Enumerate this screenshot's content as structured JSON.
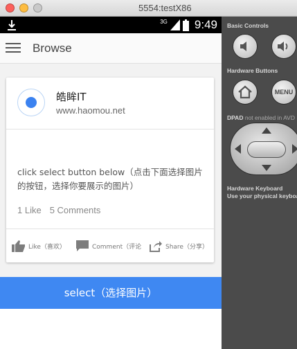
{
  "window": {
    "title": "5554:testX86"
  },
  "statusbar": {
    "network": "3G",
    "time": "9:49",
    "icons": [
      "download-icon",
      "signal-icon",
      "battery-icon"
    ]
  },
  "toolbar": {
    "title": "Browse",
    "menu_icon": "hamburger-icon"
  },
  "card": {
    "title": "皓眸IT",
    "subtitle": "www.haomou.net",
    "description": "click select button below（点击下面选择图片的按钮，选择你要展示的图片）",
    "likes": "1 Like",
    "comments": "5 Comments",
    "actions": {
      "like": "Like（喜欢）",
      "comment": "Comment（评论",
      "share": "Share（分享）"
    }
  },
  "select_button": {
    "label": "select（选择图片）"
  },
  "panel": {
    "basic_controls": "Basic Controls",
    "hardware_buttons": "Hardware Buttons",
    "menu_label": "MENU",
    "dpad_prefix": "DPAD",
    "dpad_note": "not enabled in AVD",
    "hardware_keyboard": "Hardware Keyboard",
    "keyboard_note": "Use your physical keyboard"
  },
  "colors": {
    "accent": "#3f88f2",
    "avatar": "#3b82f0",
    "panel": "#4b4b4b"
  }
}
